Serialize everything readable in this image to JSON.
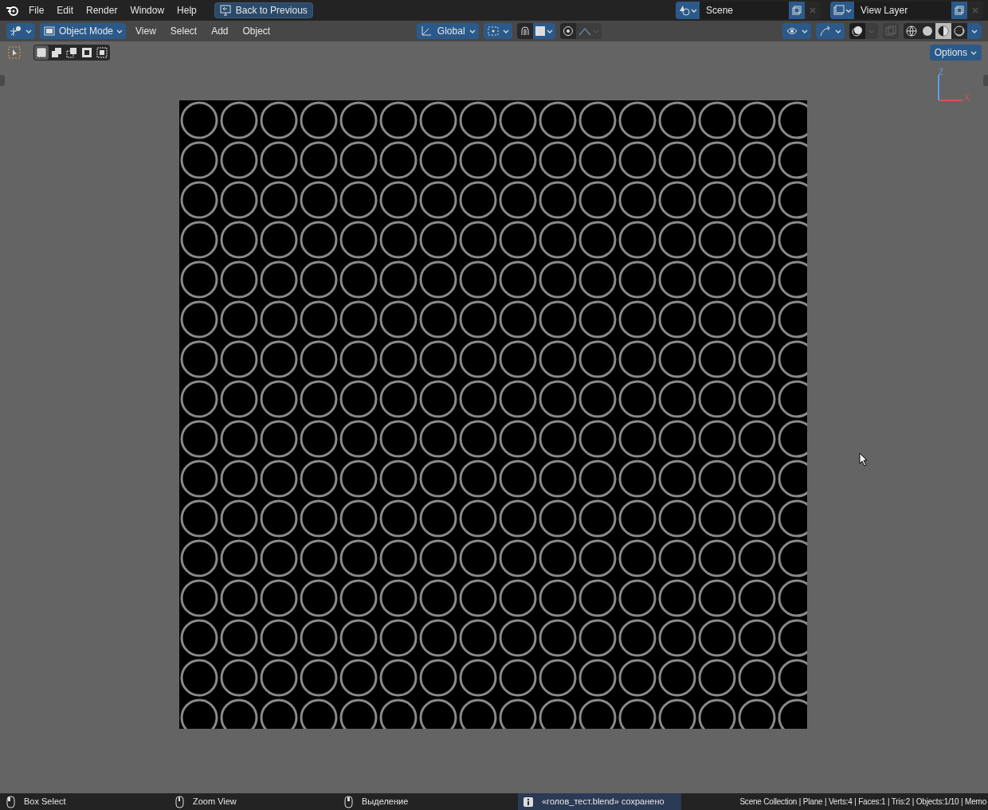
{
  "top_bar": {
    "menus": [
      "File",
      "Edit",
      "Render",
      "Window",
      "Help"
    ],
    "back_button": "Back to Previous",
    "scene": {
      "value": "Scene"
    },
    "view_layer": {
      "value": "View Layer"
    }
  },
  "viewport_header": {
    "mode": "Object Mode",
    "menus": [
      "View",
      "Select",
      "Add",
      "Object"
    ],
    "orientation": "Global"
  },
  "tool_header": {
    "select_modes": [
      {
        "selected": true
      },
      {
        "selected": false
      },
      {
        "selected": false
      },
      {
        "selected": false
      },
      {
        "selected": false
      }
    ],
    "options": "Options"
  },
  "viewport": {
    "axis_labels": [
      "Z",
      "X"
    ]
  },
  "status_bar": {
    "hints": [
      "Box Select",
      "Zoom View",
      "Выделение"
    ],
    "report": "«голов_тест.blend» сохранено",
    "stats": "Scene Collection | Plane | Verts:4 | Faces:1 | Tris:2 | Objects:1/10 | Memo"
  }
}
